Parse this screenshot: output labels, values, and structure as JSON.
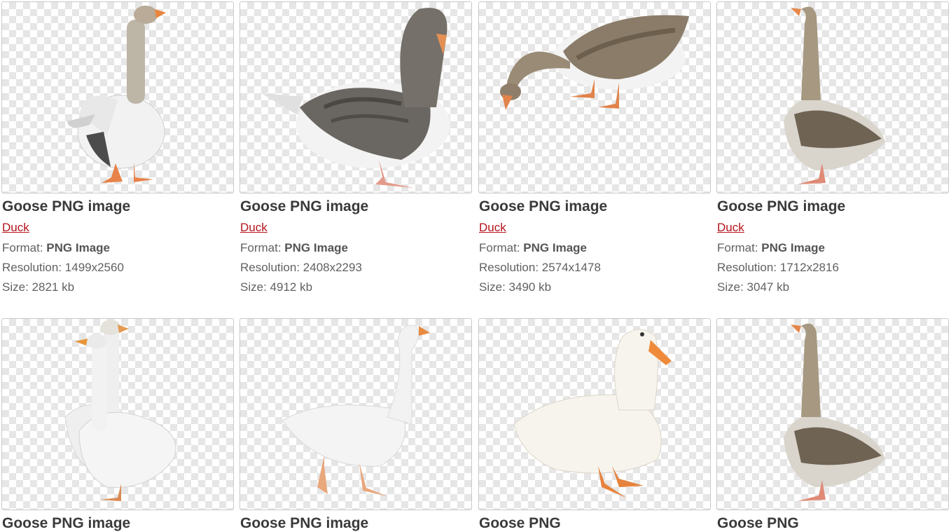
{
  "labels": {
    "format": "Format: ",
    "resolution": "Resolution: ",
    "size": "Size: "
  },
  "items": [
    {
      "title": "Goose PNG image",
      "category": "Duck",
      "format": "PNG Image",
      "resolution": "1499x2560",
      "size": "2821 kb",
      "icon": "white-goose-standing-icon"
    },
    {
      "title": "Goose PNG image",
      "category": "Duck",
      "format": "PNG Image",
      "resolution": "2408x2293",
      "size": "4912 kb",
      "icon": "grey-goose-preening-icon"
    },
    {
      "title": "Goose PNG image",
      "category": "Duck",
      "format": "PNG Image",
      "resolution": "2574x1478",
      "size": "3490 kb",
      "icon": "goose-grazing-icon"
    },
    {
      "title": "Goose PNG image",
      "category": "Duck",
      "format": "PNG Image",
      "resolution": "1712x2816",
      "size": "3047 kb",
      "icon": "brown-goose-standing-icon"
    },
    {
      "title": "Goose PNG image",
      "icon": "two-white-geese-icon"
    },
    {
      "title": "Goose PNG image",
      "icon": "white-goose-walking-icon"
    },
    {
      "title": "Goose PNG",
      "icon": "white-duck-icon"
    },
    {
      "title": "Goose PNG",
      "icon": "brown-goose-standing-icon"
    }
  ],
  "colors": {
    "link": "#b5131b",
    "title": "#3a3a3a",
    "text": "#616161",
    "checker": "#e6e6e6"
  }
}
